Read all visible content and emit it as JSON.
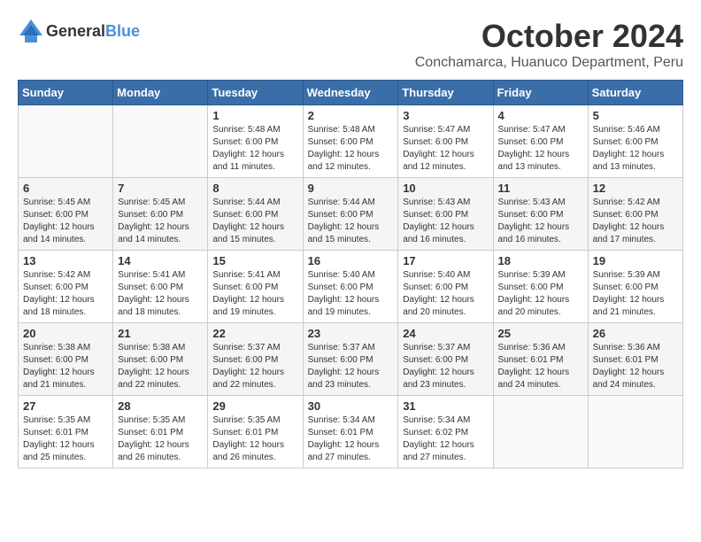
{
  "header": {
    "logo_general": "General",
    "logo_blue": "Blue",
    "month_year": "October 2024",
    "location": "Conchamarca, Huanuco Department, Peru"
  },
  "weekdays": [
    "Sunday",
    "Monday",
    "Tuesday",
    "Wednesday",
    "Thursday",
    "Friday",
    "Saturday"
  ],
  "weeks": [
    [
      {
        "day": "",
        "info": ""
      },
      {
        "day": "",
        "info": ""
      },
      {
        "day": "1",
        "info": "Sunrise: 5:48 AM\nSunset: 6:00 PM\nDaylight: 12 hours and 11 minutes."
      },
      {
        "day": "2",
        "info": "Sunrise: 5:48 AM\nSunset: 6:00 PM\nDaylight: 12 hours and 12 minutes."
      },
      {
        "day": "3",
        "info": "Sunrise: 5:47 AM\nSunset: 6:00 PM\nDaylight: 12 hours and 12 minutes."
      },
      {
        "day": "4",
        "info": "Sunrise: 5:47 AM\nSunset: 6:00 PM\nDaylight: 12 hours and 13 minutes."
      },
      {
        "day": "5",
        "info": "Sunrise: 5:46 AM\nSunset: 6:00 PM\nDaylight: 12 hours and 13 minutes."
      }
    ],
    [
      {
        "day": "6",
        "info": "Sunrise: 5:45 AM\nSunset: 6:00 PM\nDaylight: 12 hours and 14 minutes."
      },
      {
        "day": "7",
        "info": "Sunrise: 5:45 AM\nSunset: 6:00 PM\nDaylight: 12 hours and 14 minutes."
      },
      {
        "day": "8",
        "info": "Sunrise: 5:44 AM\nSunset: 6:00 PM\nDaylight: 12 hours and 15 minutes."
      },
      {
        "day": "9",
        "info": "Sunrise: 5:44 AM\nSunset: 6:00 PM\nDaylight: 12 hours and 15 minutes."
      },
      {
        "day": "10",
        "info": "Sunrise: 5:43 AM\nSunset: 6:00 PM\nDaylight: 12 hours and 16 minutes."
      },
      {
        "day": "11",
        "info": "Sunrise: 5:43 AM\nSunset: 6:00 PM\nDaylight: 12 hours and 16 minutes."
      },
      {
        "day": "12",
        "info": "Sunrise: 5:42 AM\nSunset: 6:00 PM\nDaylight: 12 hours and 17 minutes."
      }
    ],
    [
      {
        "day": "13",
        "info": "Sunrise: 5:42 AM\nSunset: 6:00 PM\nDaylight: 12 hours and 18 minutes."
      },
      {
        "day": "14",
        "info": "Sunrise: 5:41 AM\nSunset: 6:00 PM\nDaylight: 12 hours and 18 minutes."
      },
      {
        "day": "15",
        "info": "Sunrise: 5:41 AM\nSunset: 6:00 PM\nDaylight: 12 hours and 19 minutes."
      },
      {
        "day": "16",
        "info": "Sunrise: 5:40 AM\nSunset: 6:00 PM\nDaylight: 12 hours and 19 minutes."
      },
      {
        "day": "17",
        "info": "Sunrise: 5:40 AM\nSunset: 6:00 PM\nDaylight: 12 hours and 20 minutes."
      },
      {
        "day": "18",
        "info": "Sunrise: 5:39 AM\nSunset: 6:00 PM\nDaylight: 12 hours and 20 minutes."
      },
      {
        "day": "19",
        "info": "Sunrise: 5:39 AM\nSunset: 6:00 PM\nDaylight: 12 hours and 21 minutes."
      }
    ],
    [
      {
        "day": "20",
        "info": "Sunrise: 5:38 AM\nSunset: 6:00 PM\nDaylight: 12 hours and 21 minutes."
      },
      {
        "day": "21",
        "info": "Sunrise: 5:38 AM\nSunset: 6:00 PM\nDaylight: 12 hours and 22 minutes."
      },
      {
        "day": "22",
        "info": "Sunrise: 5:37 AM\nSunset: 6:00 PM\nDaylight: 12 hours and 22 minutes."
      },
      {
        "day": "23",
        "info": "Sunrise: 5:37 AM\nSunset: 6:00 PM\nDaylight: 12 hours and 23 minutes."
      },
      {
        "day": "24",
        "info": "Sunrise: 5:37 AM\nSunset: 6:00 PM\nDaylight: 12 hours and 23 minutes."
      },
      {
        "day": "25",
        "info": "Sunrise: 5:36 AM\nSunset: 6:01 PM\nDaylight: 12 hours and 24 minutes."
      },
      {
        "day": "26",
        "info": "Sunrise: 5:36 AM\nSunset: 6:01 PM\nDaylight: 12 hours and 24 minutes."
      }
    ],
    [
      {
        "day": "27",
        "info": "Sunrise: 5:35 AM\nSunset: 6:01 PM\nDaylight: 12 hours and 25 minutes."
      },
      {
        "day": "28",
        "info": "Sunrise: 5:35 AM\nSunset: 6:01 PM\nDaylight: 12 hours and 26 minutes."
      },
      {
        "day": "29",
        "info": "Sunrise: 5:35 AM\nSunset: 6:01 PM\nDaylight: 12 hours and 26 minutes."
      },
      {
        "day": "30",
        "info": "Sunrise: 5:34 AM\nSunset: 6:01 PM\nDaylight: 12 hours and 27 minutes."
      },
      {
        "day": "31",
        "info": "Sunrise: 5:34 AM\nSunset: 6:02 PM\nDaylight: 12 hours and 27 minutes."
      },
      {
        "day": "",
        "info": ""
      },
      {
        "day": "",
        "info": ""
      }
    ]
  ]
}
